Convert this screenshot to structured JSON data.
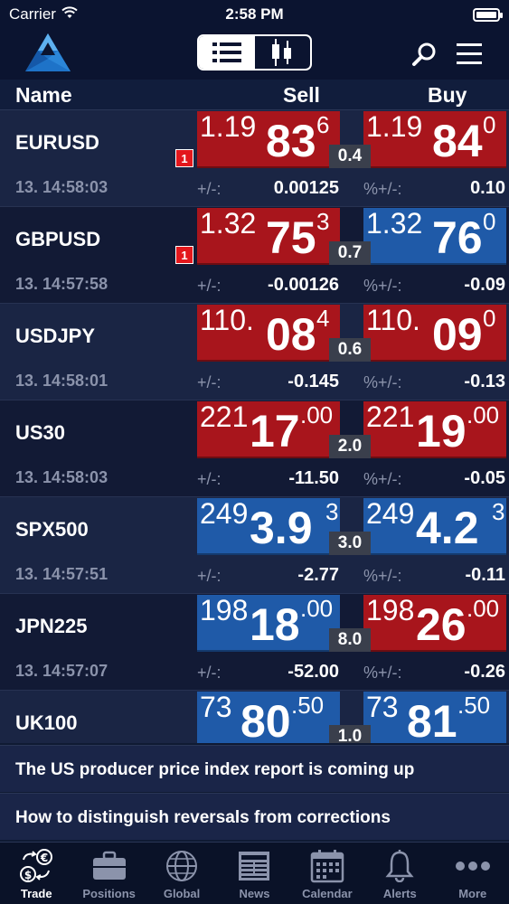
{
  "status": {
    "carrier": "Carrier",
    "time": "2:58 PM"
  },
  "columns": {
    "name": "Name",
    "sell": "Sell",
    "buy": "Buy"
  },
  "labels": {
    "change": "+/-:",
    "change_pct": "%+/-:"
  },
  "colors": {
    "down_red": "#a8151c",
    "up_blue": "#1f5aa8",
    "background": "#0f1a33"
  },
  "instruments": [
    {
      "name": "EURUSD",
      "time": "13. 14:58:03",
      "badge": "1",
      "sell": {
        "small": "1.19",
        "big": "83",
        "sup": "6",
        "color": "red"
      },
      "buy": {
        "small": "1.19",
        "big": "84",
        "sup": "0",
        "color": "red"
      },
      "spread": "0.4",
      "change": "0.00125",
      "change_pct": "0.10"
    },
    {
      "name": "GBPUSD",
      "time": "13. 14:57:58",
      "badge": "1",
      "sell": {
        "small": "1.32",
        "big": "75",
        "sup": "3",
        "color": "red"
      },
      "buy": {
        "small": "1.32",
        "big": "76",
        "sup": "0",
        "color": "blue"
      },
      "spread": "0.7",
      "change": "-0.00126",
      "change_pct": "-0.09"
    },
    {
      "name": "USDJPY",
      "time": "13. 14:58:01",
      "badge": "",
      "sell": {
        "small": "110.",
        "big": "08",
        "sup": "4",
        "color": "red"
      },
      "buy": {
        "small": "110.",
        "big": "09",
        "sup": "0",
        "color": "red"
      },
      "spread": "0.6",
      "change": "-0.145",
      "change_pct": "-0.13"
    },
    {
      "name": "US30",
      "time": "13. 14:58:03",
      "badge": "",
      "sell": {
        "small": "221",
        "big": "17",
        "sup": ".00",
        "color": "red"
      },
      "buy": {
        "small": "221",
        "big": "19",
        "sup": ".00",
        "color": "red"
      },
      "spread": "2.0",
      "change": "-11.50",
      "change_pct": "-0.05"
    },
    {
      "name": "SPX500",
      "time": "13. 14:57:51",
      "badge": "",
      "sell": {
        "small": "249",
        "big": "3.9",
        "sup": "3",
        "color": "blue"
      },
      "buy": {
        "small": "249",
        "big": "4.2",
        "sup": "3",
        "color": "blue"
      },
      "spread": "3.0",
      "change": "-2.77",
      "change_pct": "-0.11"
    },
    {
      "name": "JPN225",
      "time": "13. 14:57:07",
      "badge": "",
      "sell": {
        "small": "198",
        "big": "18",
        "sup": ".00",
        "color": "blue"
      },
      "buy": {
        "small": "198",
        "big": "26",
        "sup": ".00",
        "color": "red"
      },
      "spread": "8.0",
      "change": "-52.00",
      "change_pct": "-0.26"
    },
    {
      "name": "UK100",
      "time": "",
      "badge": "",
      "sell": {
        "small": "73",
        "big": "80",
        "sup": ".50",
        "color": "blue"
      },
      "buy": {
        "small": "73",
        "big": "81",
        "sup": ".50",
        "color": "blue"
      },
      "spread": "1.0",
      "change": "",
      "change_pct": ""
    }
  ],
  "news": [
    "The US producer price index report is coming up",
    "How to distinguish reversals from corrections"
  ],
  "tabs": [
    {
      "label": "Trade",
      "icon": "currency-exchange-icon",
      "active": true
    },
    {
      "label": "Positions",
      "icon": "briefcase-icon",
      "active": false
    },
    {
      "label": "Global",
      "icon": "globe-icon",
      "active": false
    },
    {
      "label": "News",
      "icon": "newspaper-icon",
      "active": false
    },
    {
      "label": "Calendar",
      "icon": "calendar-icon",
      "active": false
    },
    {
      "label": "Alerts",
      "icon": "bell-icon",
      "active": false
    },
    {
      "label": "More",
      "icon": "more-dots-icon",
      "active": false
    }
  ]
}
